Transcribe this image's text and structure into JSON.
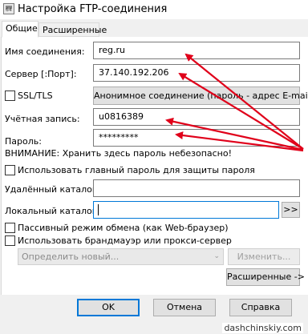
{
  "window": {
    "title": "Настройка FTP-соединения",
    "icon": "app-icon"
  },
  "tabs": [
    {
      "label": "Общие"
    },
    {
      "label": "Расширенные"
    }
  ],
  "form": {
    "connection_name_label": "Имя соединения:",
    "connection_name_value": "reg.ru",
    "server_label": "Сервер [:Порт]:",
    "server_value": "37.140.192.206",
    "ssl_label": "SSL/TLS",
    "anonymous_button": "Анонимное соединение (пароль - адрес E-mail)",
    "account_label": "Учётная запись:",
    "account_value": "u0816389",
    "password_label": "Пароль:",
    "password_value": "*********",
    "warning_text": "ВНИМАНИЕ: Хранить здесь пароль небезопасно!",
    "master_password_label": "Использовать главный пароль для защиты пароля",
    "remote_dir_label": "Удалённый каталог:",
    "remote_dir_value": "",
    "local_dir_label": "Локальный каталог:",
    "local_dir_value": "",
    "browse_button": ">>",
    "passive_mode_label": "Пассивный режим обмена (как Web-браузер)",
    "firewall_label": "Использовать брандмауэр или прокси-сервер",
    "proxy_select_value": "Определить новый...",
    "change_button": "Изменить...",
    "advanced_button": "Расширенные ->"
  },
  "footer": {
    "ok": "OK",
    "cancel": "Отмена",
    "help": "Справка"
  },
  "watermark": "dashchinskiy.com",
  "colors": {
    "arrow": "#e0001a",
    "focus_border": "#0078d7"
  }
}
